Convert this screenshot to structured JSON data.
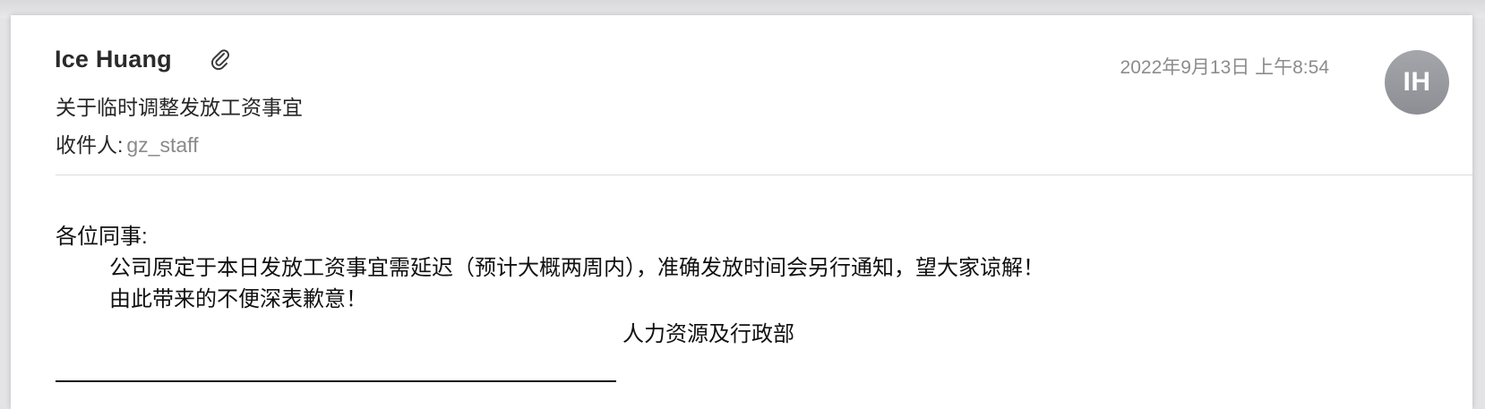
{
  "message": {
    "sender_name": "Ice Huang",
    "attachment_icon": "paperclip-icon",
    "timestamp": "2022年9月13日 上午8:54",
    "avatar_initials": "IH",
    "avatar_color": "#9a9ca1",
    "subject": "关于临时调整发放工资事宜",
    "recipient_label": "收件人:",
    "recipient": "gz_staff"
  },
  "body": {
    "greeting": "各位同事:",
    "line1": "公司原定于本日发放工资事宜需延迟（预计大概两周内），准确发放时间会另行通知，望大家谅解！",
    "line2": "由此带来的不便深表歉意！",
    "signature": "人力资源及行政部"
  }
}
